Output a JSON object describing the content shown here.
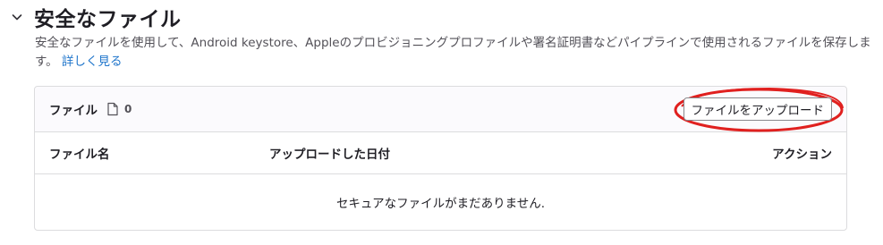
{
  "section": {
    "title": "安全なファイル",
    "description": "安全なファイルを使用して、Android keystore、Appleのプロビジョニングプロファイルや署名証明書などパイプラインで使用されるファイルを保存します。",
    "learn_more": "詳しく見る"
  },
  "card": {
    "title": "ファイル",
    "count": "0",
    "upload_button": "ファイルをアップロード",
    "columns": [
      "ファイル名",
      "アップロードした日付",
      "アクション"
    ],
    "empty_message": "セキュアなファイルがまだありません."
  },
  "colors": {
    "link": "#1f75cb",
    "annotation": "#e0201f",
    "border": "#dcdcde"
  }
}
